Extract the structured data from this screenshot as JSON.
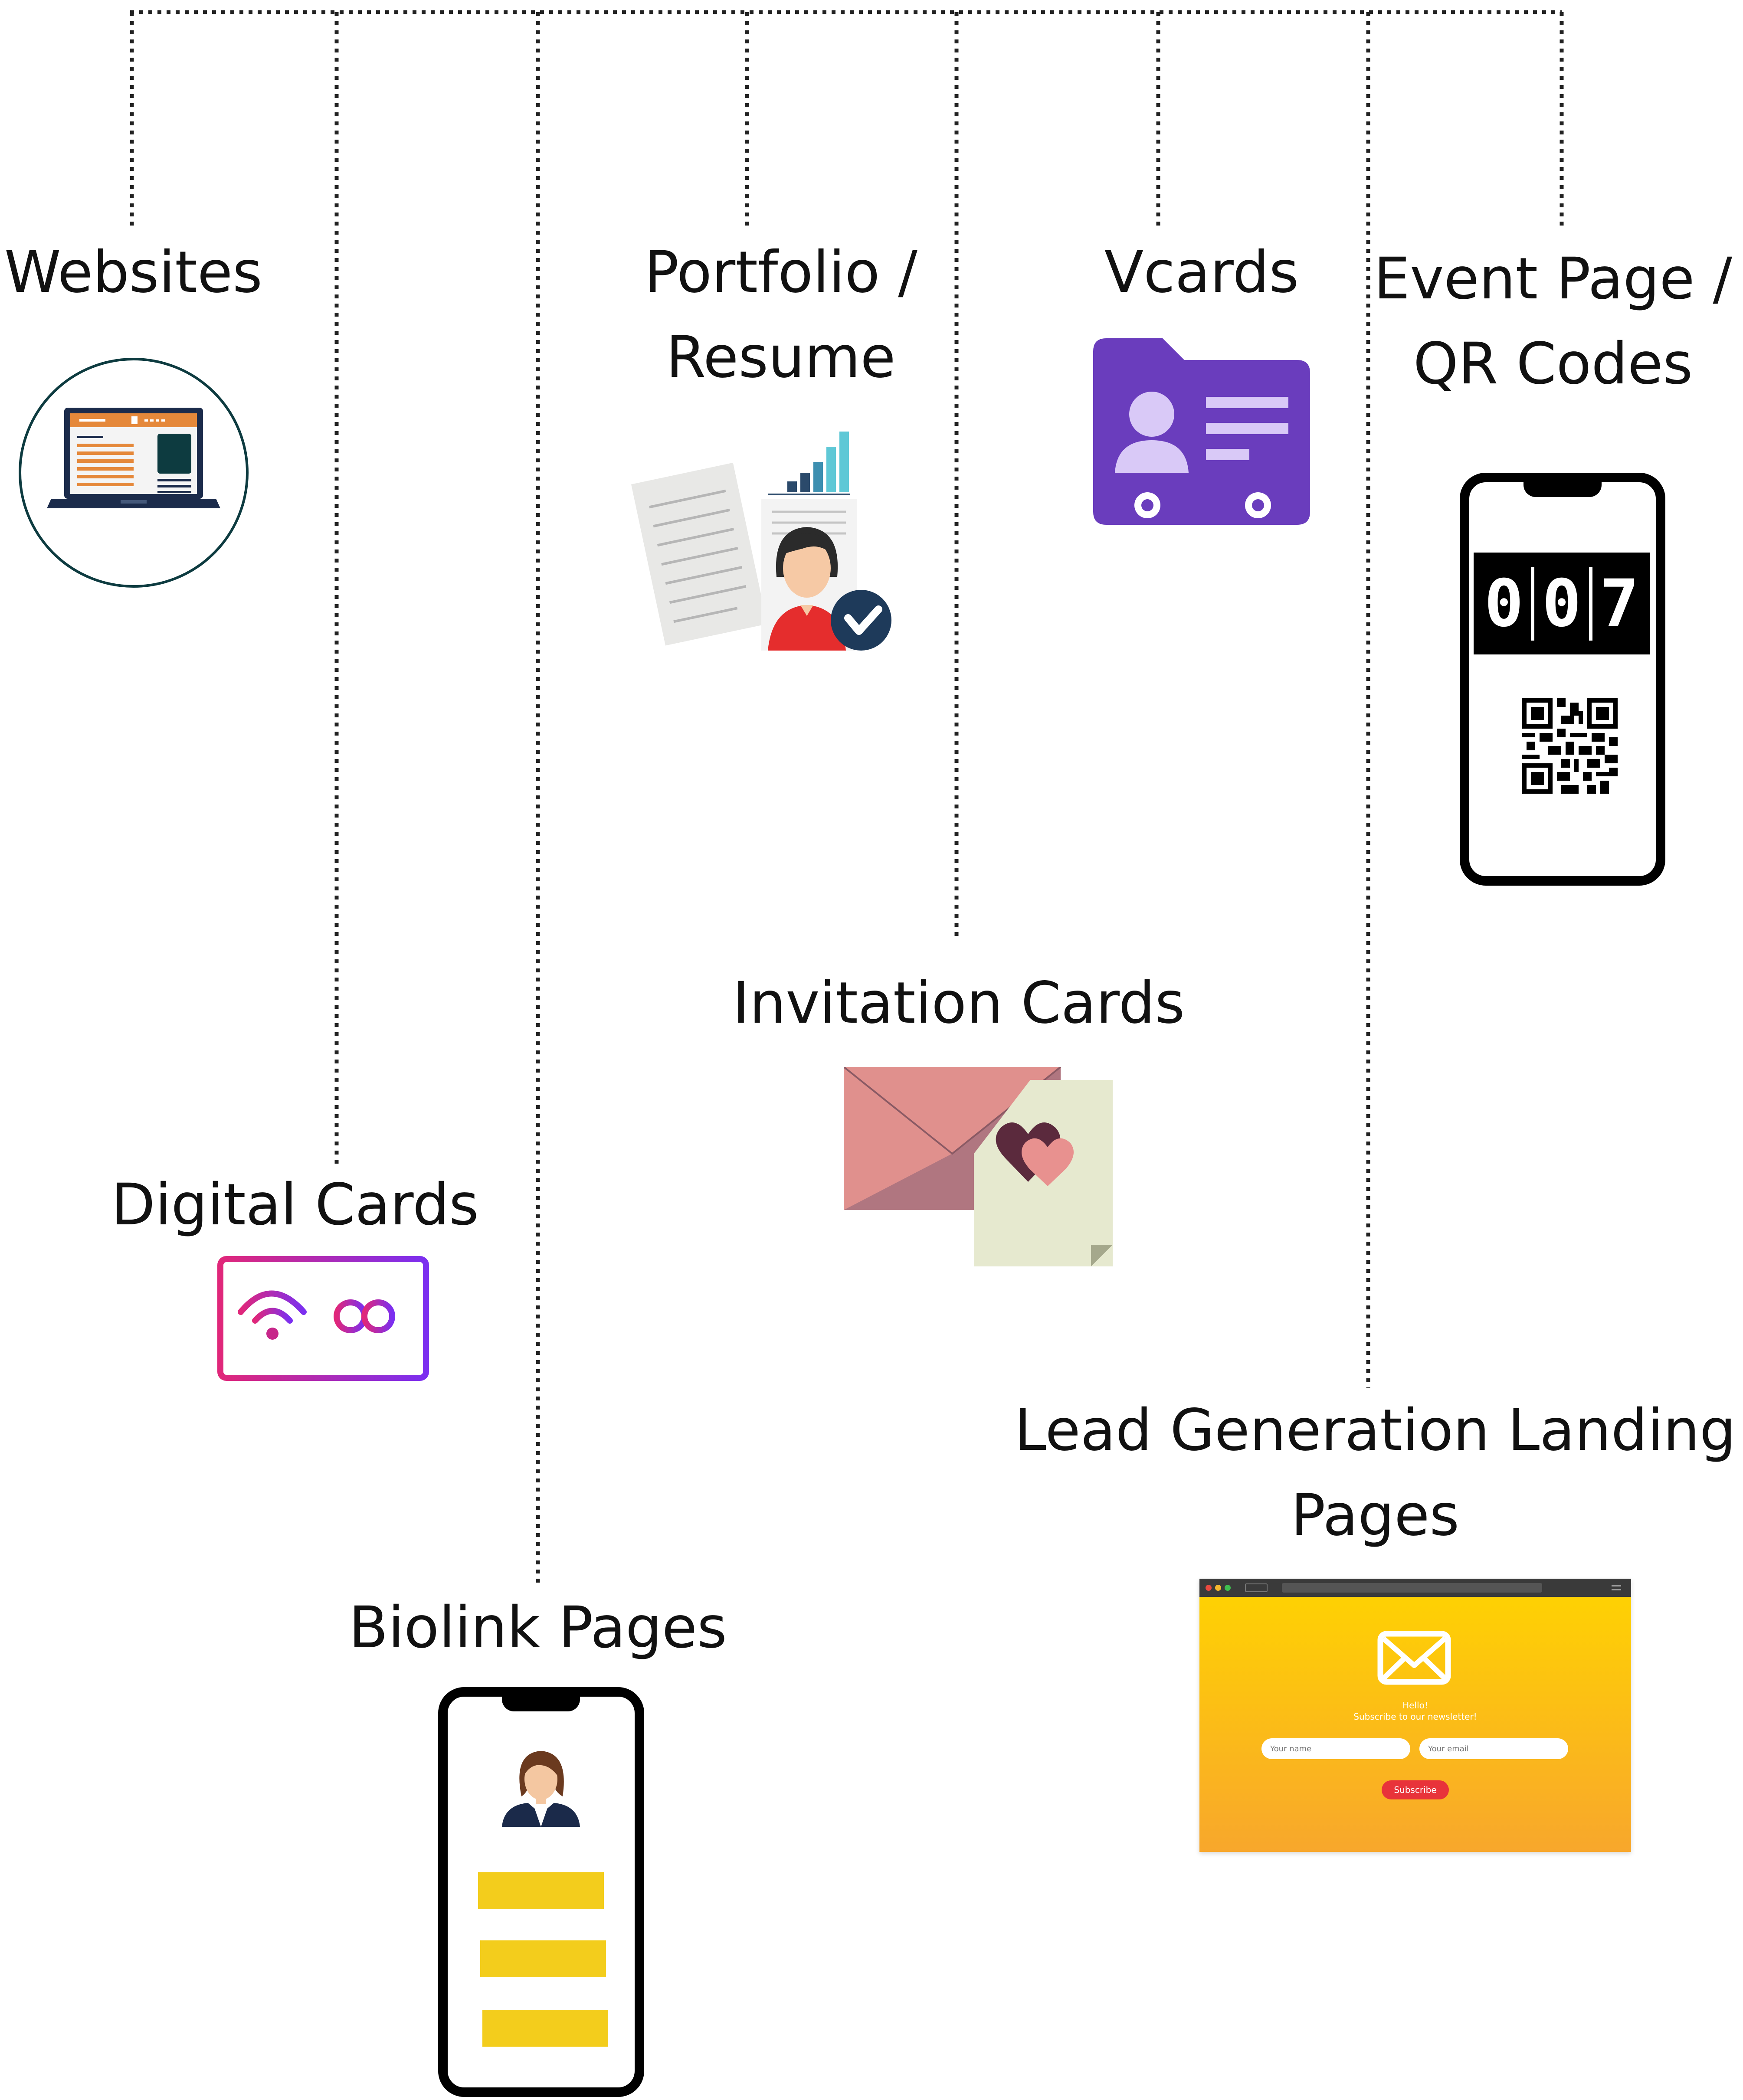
{
  "items": [
    {
      "id": "websites",
      "lines": [
        "Websites"
      ]
    },
    {
      "id": "digital-cards",
      "lines": [
        "Digital Cards"
      ]
    },
    {
      "id": "biolink-pages",
      "lines": [
        "Biolink Pages"
      ]
    },
    {
      "id": "portfolio-resume",
      "lines": [
        "Portfolio /",
        "Resume"
      ]
    },
    {
      "id": "invitation-cards",
      "lines": [
        "Invitation Cards"
      ]
    },
    {
      "id": "vcards",
      "lines": [
        "Vcards"
      ]
    },
    {
      "id": "lead-generation",
      "lines": [
        "Lead Generation Landing",
        "Pages"
      ]
    },
    {
      "id": "event-page-qr",
      "lines": [
        "Event Page /",
        "QR Codes"
      ]
    }
  ],
  "event_counter": [
    "0",
    "0",
    "7"
  ],
  "landing_mock": {
    "greeting": "Hello!",
    "subtitle": "Subscribe to our newsletter!",
    "name_placeholder": "Your name",
    "email_placeholder": "Your email",
    "button_label": "Subscribe"
  },
  "colors": {
    "connector": "#222222",
    "website_screen": "#e5883a",
    "vcard_folder": "#6a3dbd",
    "digital_card_gradient": [
      "#e0277a",
      "#7b2ff0"
    ],
    "landing_gradient": [
      "#ffd400",
      "#f8a72c"
    ],
    "subscribe_button": "#e8333a",
    "biolink_bars": "#f3cd1c"
  }
}
